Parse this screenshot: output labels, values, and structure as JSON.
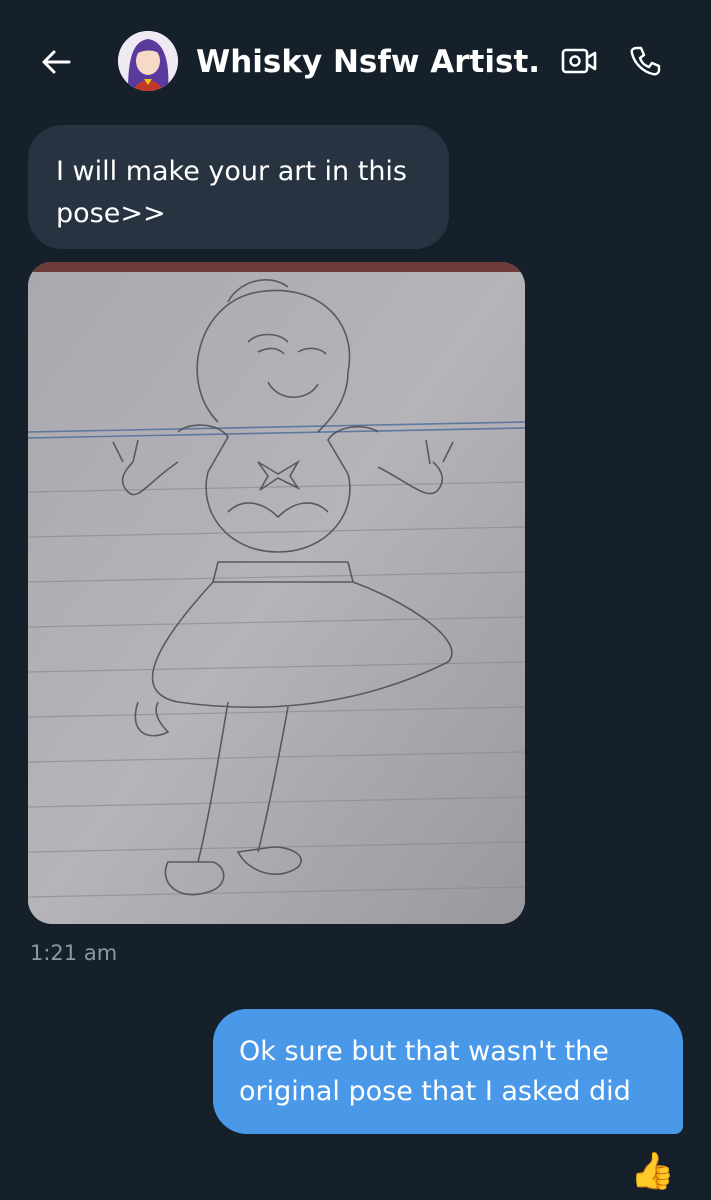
{
  "header": {
    "contact_name": "Whisky Nsfw Artist...",
    "back_icon": "arrow-left-icon",
    "video_icon": "video-call-icon",
    "call_icon": "phone-icon"
  },
  "messages": {
    "incoming_text": "I will make your art in this pose>>",
    "incoming_time": "1:21 am",
    "outgoing_text": "Ok sure but that wasn't the original pose that I asked did",
    "reaction": "👍"
  },
  "colors": {
    "background": "#15202b",
    "incoming_bubble": "#273340",
    "outgoing_bubble": "#4a99e9",
    "timestamp": "#8b98a5"
  }
}
